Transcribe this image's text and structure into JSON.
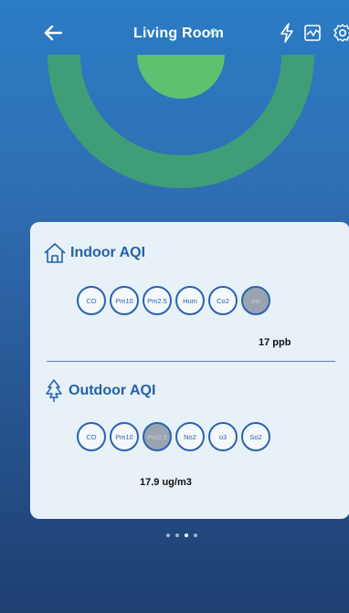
{
  "header": {
    "title": "Living Room",
    "back_icon": "arrow-left-icon",
    "actions": [
      "bolt-icon",
      "chart-icon",
      "gear-icon"
    ]
  },
  "colors": {
    "accent": "#2362a8",
    "gauge_inner": "#5fc070",
    "gauge_outer": "#3f9e78",
    "status": "#8fe3a3"
  },
  "indoor": {
    "title": "Indoor AQI",
    "icon": "house-icon",
    "chips": [
      "CO",
      "Pm10",
      "Pm2.5",
      "Hum",
      "Co2",
      "Ins"
    ],
    "active_index": 5,
    "reading": "17 ppb"
  },
  "outdoor": {
    "title": "Outdoor AQI",
    "icon": "tree-icon",
    "chips": [
      "CO",
      "Pm10",
      "Pm2.5",
      "No2",
      "o3",
      "So2"
    ],
    "active_index": 2,
    "reading": "17.9 ug/m3"
  },
  "pager": {
    "pages": 4,
    "current": 2
  }
}
